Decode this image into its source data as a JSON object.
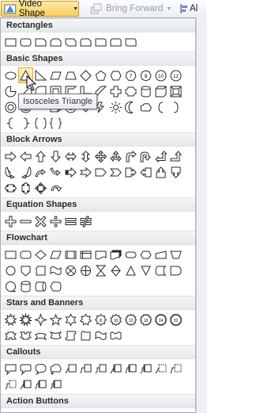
{
  "ribbon": {
    "video_shape_label": "Video Shape",
    "bring_forward_label": "Bring Forward",
    "align_label": "Al",
    "dropdown_arrow": "▼"
  },
  "tooltip": {
    "text": "Isosceles Triangle"
  },
  "sections": [
    {
      "id": "rectangles",
      "title": "Rectangles",
      "rows": [
        [
          "rect",
          "rrect",
          "snip1",
          "snip2",
          "snip3",
          "sniprnd",
          "rnd1",
          "rnd2",
          "rnd3"
        ]
      ]
    },
    {
      "id": "basic",
      "title": "Basic Shapes",
      "rows": [
        [
          "ellipse",
          "isoTri",
          "rtTri",
          "parallelogram",
          "trapezoid",
          "diamond",
          "pentagon",
          "hexagon",
          "n7",
          "n8",
          "n10",
          "n12"
        ],
        [
          "pie",
          "chord",
          "teardrop",
          "frame",
          "halfframe",
          "lshape",
          "diagstripe",
          "plus",
          "plaque",
          "can",
          "cube",
          "bevel"
        ],
        [
          "donut",
          "nosmoking",
          "blockarc",
          "foldedcorner",
          "smiley",
          "heart",
          "lightning",
          "sun",
          "moon",
          "cloud",
          "lbracket",
          "rbracket"
        ],
        [
          "lbrace",
          "rbrace",
          "bracketpair",
          "bracepair"
        ]
      ]
    },
    {
      "id": "arrows",
      "title": "Block Arrows",
      "rows": [
        [
          "aright",
          "aleft",
          "aup",
          "adown",
          "alr",
          "aud",
          "aquad",
          "alru",
          "abent",
          "auturn",
          "alup",
          "abentup"
        ],
        [
          "acurvR",
          "acurvL",
          "acurvU",
          "acurvD",
          "astriped",
          "anotched",
          "apentagon",
          "achevron",
          "arcallout",
          "alcallout",
          "aucallout",
          "adcallout"
        ],
        [
          "alrcallout",
          "audcallout",
          "aquadcallout",
          "acircular"
        ]
      ]
    },
    {
      "id": "equation",
      "title": "Equation Shapes",
      "rows": [
        [
          "eplus",
          "eminus",
          "emult",
          "ediv",
          "eequal",
          "enotequal"
        ]
      ]
    },
    {
      "id": "flowchart",
      "title": "Flowchart",
      "rows": [
        [
          "fprocess",
          "faltprocess",
          "fdecision",
          "fdata",
          "fpredef",
          "finternal",
          "fdocument",
          "fmultidoc",
          "fterminator",
          "fprep",
          "fmanualinput",
          "fmanualop"
        ],
        [
          "fconnector",
          "fofconnector",
          "fcard",
          "fpunchtape",
          "fsumjunction",
          "for",
          "fcollate",
          "fsort",
          "fextract",
          "fmerge",
          "fstored",
          "fdelay"
        ],
        [
          "fseqaccess",
          "fmagdisk",
          "fdirectaccess",
          "fdisplay"
        ]
      ]
    },
    {
      "id": "stars",
      "title": "Stars and Banners",
      "rows": [
        [
          "expl1",
          "expl2",
          "star4",
          "star5",
          "star6",
          "star7",
          "star8",
          "star10",
          "star12",
          "star16",
          "star24",
          "star32"
        ],
        [
          "ribbonup",
          "ribbondown",
          "ribboncurvup",
          "ribboncurvdown",
          "scrollv",
          "scrollh",
          "wave",
          "dblwave"
        ]
      ]
    },
    {
      "id": "callouts",
      "title": "Callouts",
      "rows": [
        [
          "crect",
          "crrect",
          "coval",
          "ccloud",
          "cline1",
          "cline2",
          "cline3",
          "cacc1",
          "cacc2",
          "cacc3",
          "cbord1",
          "cbord2"
        ],
        [
          "cbord3",
          "cab1",
          "cab2",
          "cab3"
        ]
      ]
    },
    {
      "id": "action",
      "title": "Action Buttons",
      "rows": [
        [
          "abback",
          "abforward",
          "abbegin",
          "abend",
          "abhome",
          "abinfo",
          "abreturn",
          "abmovie",
          "abdoc",
          "absound",
          "abhelp",
          "abblank"
        ]
      ]
    }
  ],
  "selected_shape": "isoTri"
}
